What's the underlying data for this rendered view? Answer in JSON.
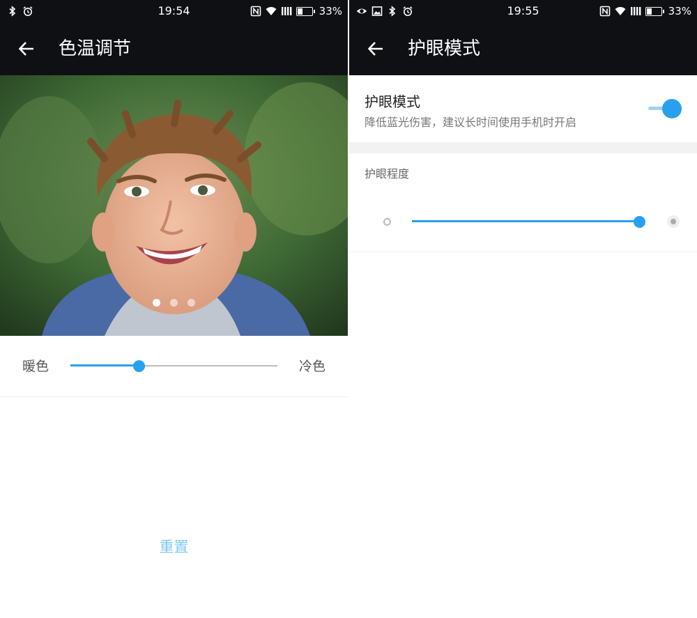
{
  "left_screen": {
    "status": {
      "time": "19:54",
      "battery_text": "33%",
      "battery_level": 0.33
    },
    "appbar": {
      "title": "色温调节"
    },
    "carousel": {
      "page_count": 3,
      "active_index": 0
    },
    "color_temp": {
      "warm_label": "暖色",
      "cool_label": "冷色",
      "value": 0.33
    },
    "reset_label": "重置"
  },
  "right_screen": {
    "status": {
      "time": "19:55",
      "battery_text": "33%",
      "battery_level": 0.33
    },
    "appbar": {
      "title": "护眼模式"
    },
    "eye_mode": {
      "title": "护眼模式",
      "description": "降低蓝光伤害，建议长时间使用手机时开启",
      "enabled": true
    },
    "level": {
      "label": "护眼程度",
      "value": 1.0
    }
  },
  "colors": {
    "accent": "#28a0ee",
    "bar_background": "#0f1014",
    "reset_text": "#7fc7f3"
  },
  "icons": {
    "back": "arrow-left-icon",
    "bluetooth": "bluetooth-icon",
    "alarm": "alarm-icon",
    "eye": "eye-icon",
    "gallery": "image-icon",
    "nfc": "nfc-icon",
    "wifi": "wifi-icon",
    "signal": "signal-icon"
  }
}
